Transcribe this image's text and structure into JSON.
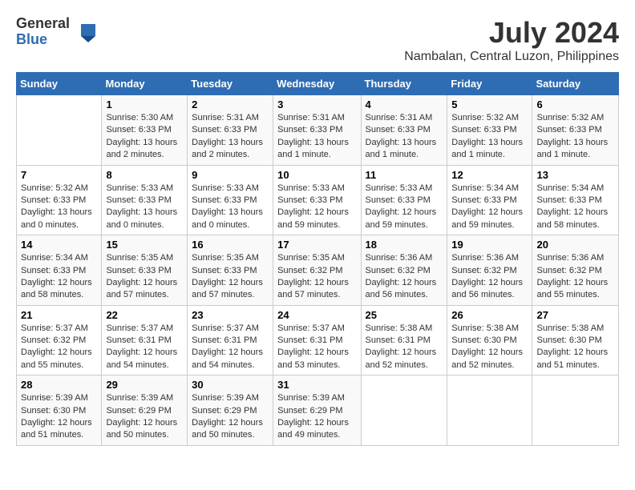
{
  "header": {
    "logo_general": "General",
    "logo_blue": "Blue",
    "title": "July 2024",
    "subtitle": "Nambalan, Central Luzon, Philippines"
  },
  "calendar": {
    "days_of_week": [
      "Sunday",
      "Monday",
      "Tuesday",
      "Wednesday",
      "Thursday",
      "Friday",
      "Saturday"
    ],
    "weeks": [
      [
        {
          "day": "",
          "sunrise": "",
          "sunset": "",
          "daylight": ""
        },
        {
          "day": "1",
          "sunrise": "Sunrise: 5:30 AM",
          "sunset": "Sunset: 6:33 PM",
          "daylight": "Daylight: 13 hours and 2 minutes."
        },
        {
          "day": "2",
          "sunrise": "Sunrise: 5:31 AM",
          "sunset": "Sunset: 6:33 PM",
          "daylight": "Daylight: 13 hours and 2 minutes."
        },
        {
          "day": "3",
          "sunrise": "Sunrise: 5:31 AM",
          "sunset": "Sunset: 6:33 PM",
          "daylight": "Daylight: 13 hours and 1 minute."
        },
        {
          "day": "4",
          "sunrise": "Sunrise: 5:31 AM",
          "sunset": "Sunset: 6:33 PM",
          "daylight": "Daylight: 13 hours and 1 minute."
        },
        {
          "day": "5",
          "sunrise": "Sunrise: 5:32 AM",
          "sunset": "Sunset: 6:33 PM",
          "daylight": "Daylight: 13 hours and 1 minute."
        },
        {
          "day": "6",
          "sunrise": "Sunrise: 5:32 AM",
          "sunset": "Sunset: 6:33 PM",
          "daylight": "Daylight: 13 hours and 1 minute."
        }
      ],
      [
        {
          "day": "7",
          "sunrise": "Sunrise: 5:32 AM",
          "sunset": "Sunset: 6:33 PM",
          "daylight": "Daylight: 13 hours and 0 minutes."
        },
        {
          "day": "8",
          "sunrise": "Sunrise: 5:33 AM",
          "sunset": "Sunset: 6:33 PM",
          "daylight": "Daylight: 13 hours and 0 minutes."
        },
        {
          "day": "9",
          "sunrise": "Sunrise: 5:33 AM",
          "sunset": "Sunset: 6:33 PM",
          "daylight": "Daylight: 13 hours and 0 minutes."
        },
        {
          "day": "10",
          "sunrise": "Sunrise: 5:33 AM",
          "sunset": "Sunset: 6:33 PM",
          "daylight": "Daylight: 12 hours and 59 minutes."
        },
        {
          "day": "11",
          "sunrise": "Sunrise: 5:33 AM",
          "sunset": "Sunset: 6:33 PM",
          "daylight": "Daylight: 12 hours and 59 minutes."
        },
        {
          "day": "12",
          "sunrise": "Sunrise: 5:34 AM",
          "sunset": "Sunset: 6:33 PM",
          "daylight": "Daylight: 12 hours and 59 minutes."
        },
        {
          "day": "13",
          "sunrise": "Sunrise: 5:34 AM",
          "sunset": "Sunset: 6:33 PM",
          "daylight": "Daylight: 12 hours and 58 minutes."
        }
      ],
      [
        {
          "day": "14",
          "sunrise": "Sunrise: 5:34 AM",
          "sunset": "Sunset: 6:33 PM",
          "daylight": "Daylight: 12 hours and 58 minutes."
        },
        {
          "day": "15",
          "sunrise": "Sunrise: 5:35 AM",
          "sunset": "Sunset: 6:33 PM",
          "daylight": "Daylight: 12 hours and 57 minutes."
        },
        {
          "day": "16",
          "sunrise": "Sunrise: 5:35 AM",
          "sunset": "Sunset: 6:33 PM",
          "daylight": "Daylight: 12 hours and 57 minutes."
        },
        {
          "day": "17",
          "sunrise": "Sunrise: 5:35 AM",
          "sunset": "Sunset: 6:32 PM",
          "daylight": "Daylight: 12 hours and 57 minutes."
        },
        {
          "day": "18",
          "sunrise": "Sunrise: 5:36 AM",
          "sunset": "Sunset: 6:32 PM",
          "daylight": "Daylight: 12 hours and 56 minutes."
        },
        {
          "day": "19",
          "sunrise": "Sunrise: 5:36 AM",
          "sunset": "Sunset: 6:32 PM",
          "daylight": "Daylight: 12 hours and 56 minutes."
        },
        {
          "day": "20",
          "sunrise": "Sunrise: 5:36 AM",
          "sunset": "Sunset: 6:32 PM",
          "daylight": "Daylight: 12 hours and 55 minutes."
        }
      ],
      [
        {
          "day": "21",
          "sunrise": "Sunrise: 5:37 AM",
          "sunset": "Sunset: 6:32 PM",
          "daylight": "Daylight: 12 hours and 55 minutes."
        },
        {
          "day": "22",
          "sunrise": "Sunrise: 5:37 AM",
          "sunset": "Sunset: 6:31 PM",
          "daylight": "Daylight: 12 hours and 54 minutes."
        },
        {
          "day": "23",
          "sunrise": "Sunrise: 5:37 AM",
          "sunset": "Sunset: 6:31 PM",
          "daylight": "Daylight: 12 hours and 54 minutes."
        },
        {
          "day": "24",
          "sunrise": "Sunrise: 5:37 AM",
          "sunset": "Sunset: 6:31 PM",
          "daylight": "Daylight: 12 hours and 53 minutes."
        },
        {
          "day": "25",
          "sunrise": "Sunrise: 5:38 AM",
          "sunset": "Sunset: 6:31 PM",
          "daylight": "Daylight: 12 hours and 52 minutes."
        },
        {
          "day": "26",
          "sunrise": "Sunrise: 5:38 AM",
          "sunset": "Sunset: 6:30 PM",
          "daylight": "Daylight: 12 hours and 52 minutes."
        },
        {
          "day": "27",
          "sunrise": "Sunrise: 5:38 AM",
          "sunset": "Sunset: 6:30 PM",
          "daylight": "Daylight: 12 hours and 51 minutes."
        }
      ],
      [
        {
          "day": "28",
          "sunrise": "Sunrise: 5:39 AM",
          "sunset": "Sunset: 6:30 PM",
          "daylight": "Daylight: 12 hours and 51 minutes."
        },
        {
          "day": "29",
          "sunrise": "Sunrise: 5:39 AM",
          "sunset": "Sunset: 6:29 PM",
          "daylight": "Daylight: 12 hours and 50 minutes."
        },
        {
          "day": "30",
          "sunrise": "Sunrise: 5:39 AM",
          "sunset": "Sunset: 6:29 PM",
          "daylight": "Daylight: 12 hours and 50 minutes."
        },
        {
          "day": "31",
          "sunrise": "Sunrise: 5:39 AM",
          "sunset": "Sunset: 6:29 PM",
          "daylight": "Daylight: 12 hours and 49 minutes."
        },
        {
          "day": "",
          "sunrise": "",
          "sunset": "",
          "daylight": ""
        },
        {
          "day": "",
          "sunrise": "",
          "sunset": "",
          "daylight": ""
        },
        {
          "day": "",
          "sunrise": "",
          "sunset": "",
          "daylight": ""
        }
      ]
    ]
  }
}
